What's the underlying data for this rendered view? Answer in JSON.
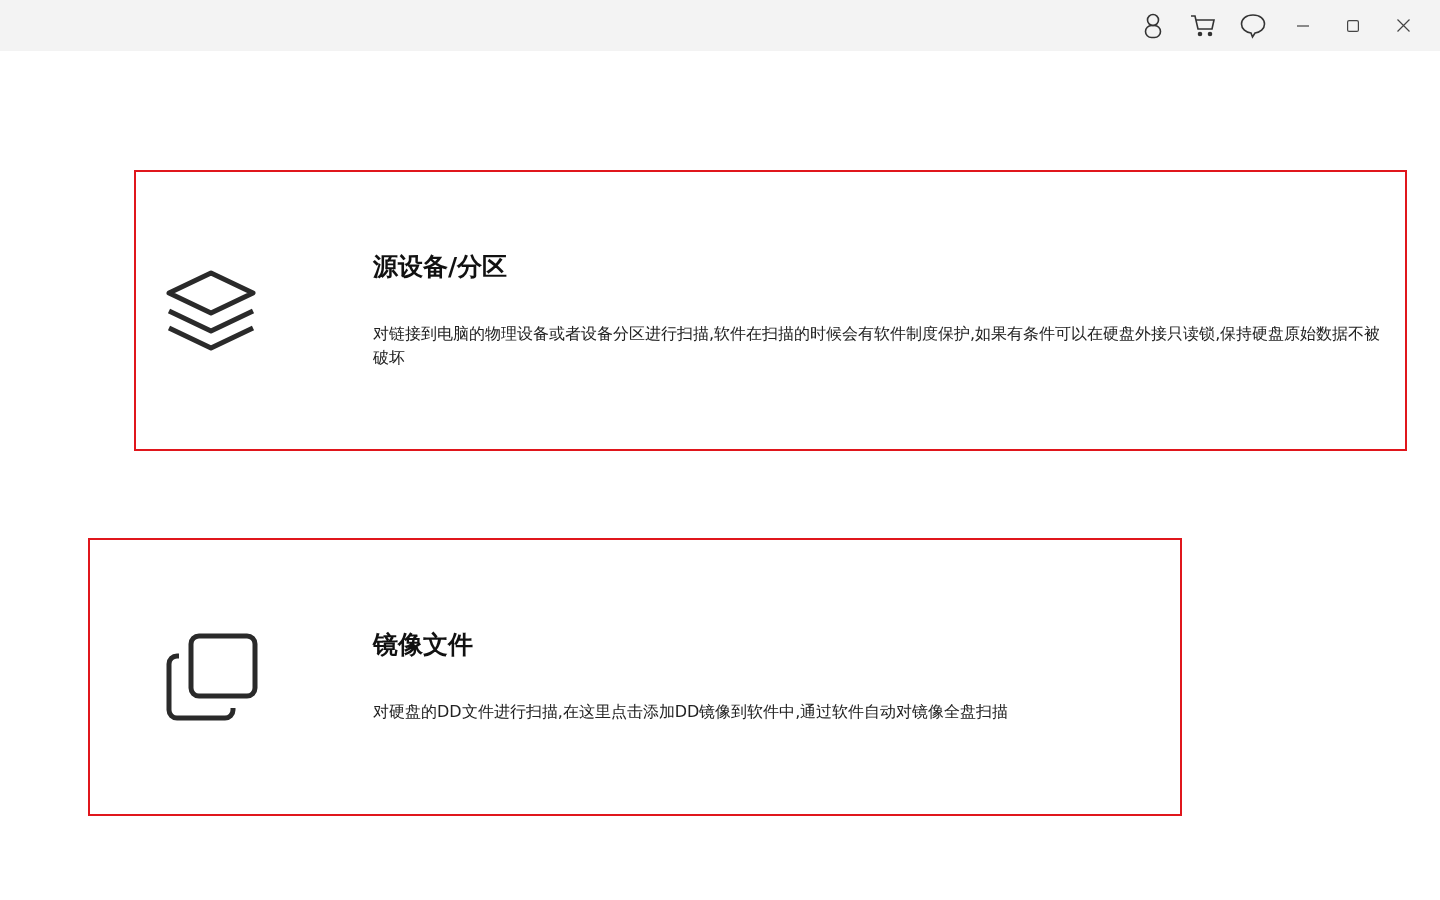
{
  "cards": [
    {
      "kind": "layers",
      "title": "源设备/分区",
      "description": "对链接到电脑的物理设备或者设备分区进行扫描,软件在扫描的时候会有软件制度保护,如果有条件可以在硬盘外接只读锁,保持硬盘原始数据不被破坏"
    },
    {
      "kind": "copy",
      "title": "镜像文件",
      "description": "对硬盘的DD文件进行扫描,在这里点击添加DD镜像到软件中,通过软件自动对镜像全盘扫描"
    }
  ]
}
